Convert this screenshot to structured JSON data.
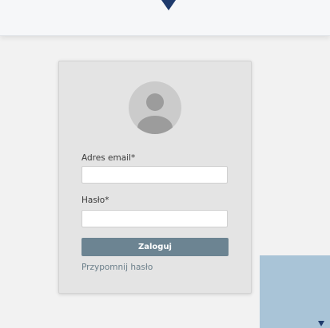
{
  "header": {
    "indicator_icon": "caret-down-icon"
  },
  "login": {
    "avatar_icon": "user-avatar-icon",
    "email_label": "Adres email*",
    "email_value": "",
    "password_label": "Hasło*",
    "password_value": "",
    "submit_label": "Zaloguj",
    "remind_label": "Przypomnij hasło"
  },
  "colors": {
    "page_background": "#f2f2f2",
    "card_background": "#e4e4e4",
    "button_background": "#6c8492",
    "link_color": "#6b7f8a",
    "accent_navy": "#1f3b6d",
    "overlay_blue": "#a9c4d7"
  }
}
